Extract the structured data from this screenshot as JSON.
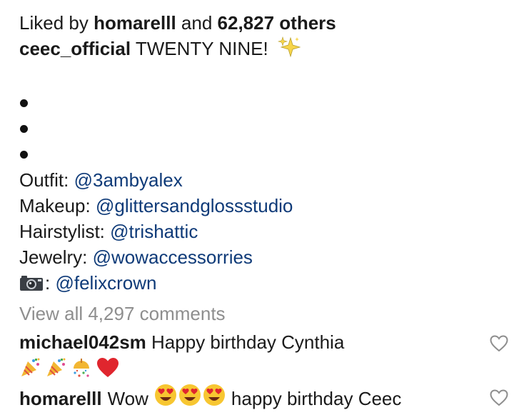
{
  "likes": {
    "prefix": "Liked by",
    "user": "homarelll",
    "conj": "and",
    "count": "62,827 others"
  },
  "caption": {
    "author": "ceec_official",
    "text": "TWENTY NINE!",
    "credits": [
      {
        "label": "Outfit:",
        "handle": "@3ambyalex"
      },
      {
        "label": "Makeup:",
        "handle": "@glittersandglossstudio"
      },
      {
        "label": "Hairstylist:",
        "handle": "@trishattic"
      },
      {
        "label": "Jewelry:",
        "handle": "@wowaccessorries"
      }
    ],
    "photo_credit": {
      "label": ":",
      "handle": "@felixcrown",
      "icon": "camera-icon"
    }
  },
  "comments_link": "View all 4,297 comments",
  "comments": [
    {
      "user": "michael042sm",
      "text": "Happy birthday Cynthia"
    },
    {
      "user": "homarelll",
      "text_before": "Wow",
      "text_after": "happy birthday Ceec"
    }
  ],
  "colors": {
    "link": "#0e3a78",
    "muted": "#8e8e8e",
    "text": "#1a1a1a"
  }
}
